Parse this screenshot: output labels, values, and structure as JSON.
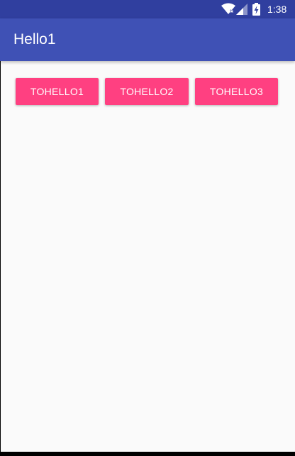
{
  "status_bar": {
    "time": "1:38",
    "icons": [
      "wifi-icon",
      "signal-icon",
      "battery-charging-icon"
    ],
    "background_color": "#303f9f"
  },
  "app_bar": {
    "title": "Hello1",
    "background_color": "#3f51b5"
  },
  "buttons": [
    {
      "label": "TOHELLO1"
    },
    {
      "label": "TOHELLO2"
    },
    {
      "label": "TOHELLO3"
    }
  ],
  "colors": {
    "accent": "#ff4081",
    "background": "#fafafa"
  }
}
